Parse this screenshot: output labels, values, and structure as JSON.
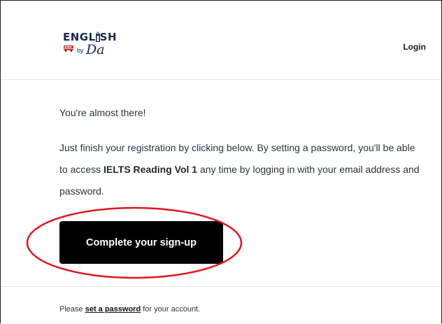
{
  "header": {
    "logo": {
      "top_text_left": "ENGL",
      "top_text_right": "SH",
      "by_text": "by",
      "script_text": "Da"
    },
    "login_label": "Login"
  },
  "main": {
    "greeting": "You're almost there!",
    "paragraph": {
      "before": "Just finish your registration by clicking below. By setting a password, you'll be able to access ",
      "product": "IELTS Reading Vol 1",
      "after": " any time by logging in with your email address and password."
    },
    "cta_label": "Complete your sign-up"
  },
  "footer": {
    "prefix": "Please ",
    "link_label": "set a password",
    "suffix": " for your account."
  },
  "colors": {
    "annotation": "#e0161d",
    "button": "#000000",
    "logo_navy": "#1b2a4a"
  }
}
